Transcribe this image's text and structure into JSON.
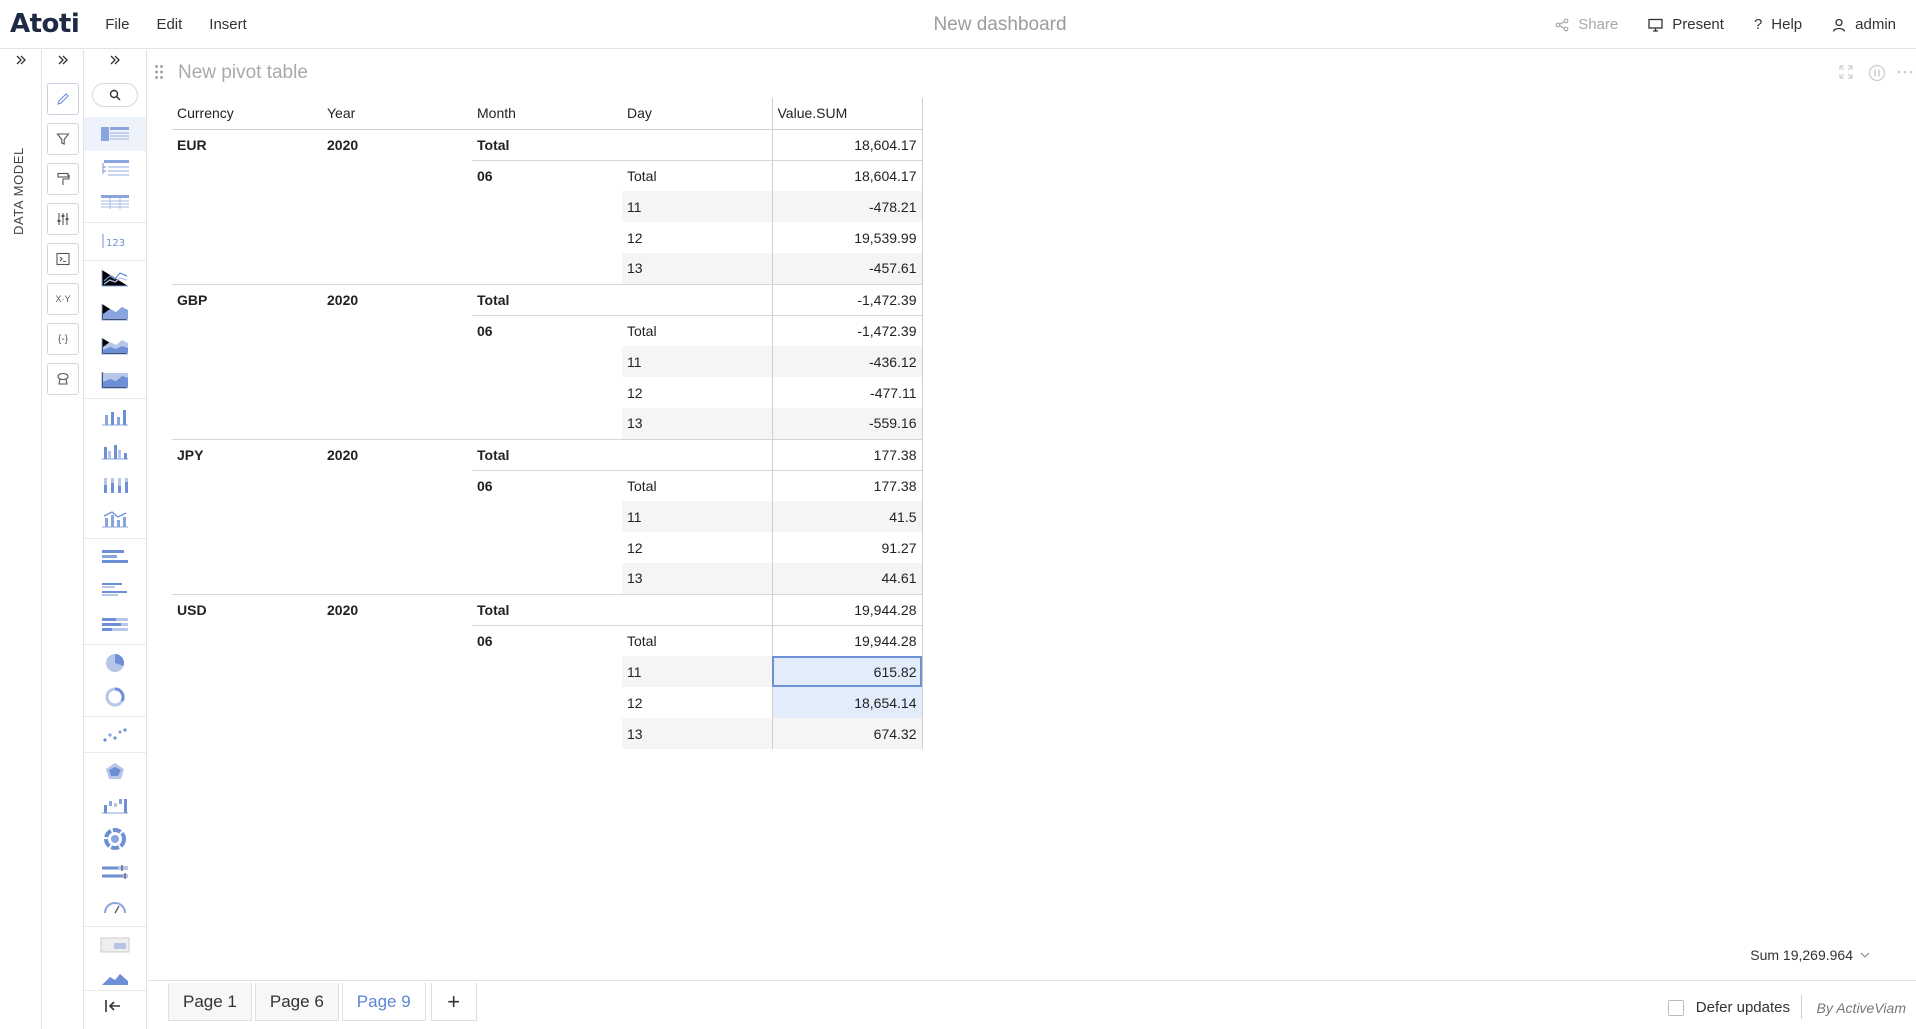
{
  "header": {
    "logo": "Atoti",
    "menu": [
      "File",
      "Edit",
      "Insert"
    ],
    "title": "New dashboard",
    "share_label": "Share",
    "present_label": "Present",
    "help_label": "Help",
    "user_label": "admin"
  },
  "sidebar": {
    "data_model_label": "DATA MODEL",
    "tools": [
      "pencil-icon",
      "filter-icon",
      "paint-roller-icon",
      "sliders-icon",
      "terminal-icon",
      "xy-icon",
      "braces-icon",
      "context-icon"
    ],
    "widgets": [
      "pivot-table",
      "tree-table",
      "table",
      "kpi",
      "line-chart",
      "area-chart",
      "stacked-area-chart",
      "percent-area-chart",
      "column-chart",
      "clustered-column-chart",
      "stacked-column-chart",
      "combo-chart",
      "bar-chart",
      "clustered-bar-chart",
      "stacked-bar-chart",
      "pie-chart",
      "donut-chart",
      "scatter-plot",
      "radar-chart",
      "waterfall-chart",
      "sunburst-chart",
      "bullet-chart",
      "gauge",
      "text-editor",
      "mountain-chart"
    ]
  },
  "widget": {
    "title": "New pivot table"
  },
  "pivot": {
    "headers": [
      "Currency",
      "Year",
      "Month",
      "Day",
      "Value.SUM"
    ],
    "groups": [
      {
        "currency": "EUR",
        "year": "2020",
        "total_label": "Total",
        "total": "18,604.17",
        "month": "06",
        "month_total_label": "Total",
        "month_total": "18,604.17",
        "days": [
          {
            "day": "11",
            "value": "-478.21"
          },
          {
            "day": "12",
            "value": "19,539.99"
          },
          {
            "day": "13",
            "value": "-457.61"
          }
        ]
      },
      {
        "currency": "GBP",
        "year": "2020",
        "total_label": "Total",
        "total": "-1,472.39",
        "month": "06",
        "month_total_label": "Total",
        "month_total": "-1,472.39",
        "days": [
          {
            "day": "11",
            "value": "-436.12"
          },
          {
            "day": "12",
            "value": "-477.11"
          },
          {
            "day": "13",
            "value": "-559.16"
          }
        ]
      },
      {
        "currency": "JPY",
        "year": "2020",
        "total_label": "Total",
        "total": "177.38",
        "month": "06",
        "month_total_label": "Total",
        "month_total": "177.38",
        "days": [
          {
            "day": "11",
            "value": "41.5"
          },
          {
            "day": "12",
            "value": "91.27"
          },
          {
            "day": "13",
            "value": "44.61"
          }
        ]
      },
      {
        "currency": "USD",
        "year": "2020",
        "total_label": "Total",
        "total": "19,944.28",
        "month": "06",
        "month_total_label": "Total",
        "month_total": "19,944.28",
        "days": [
          {
            "day": "11",
            "value": "615.82"
          },
          {
            "day": "12",
            "value": "18,654.14"
          },
          {
            "day": "13",
            "value": "674.32"
          }
        ]
      }
    ]
  },
  "status": {
    "sum_label": "Sum 19,269.964"
  },
  "footer": {
    "tabs": [
      "Page 1",
      "Page 6",
      "Page 9"
    ],
    "active_tab": "Page 9",
    "add_label": "+",
    "defer_label": "Defer updates",
    "brand": "By ActiveViam"
  }
}
